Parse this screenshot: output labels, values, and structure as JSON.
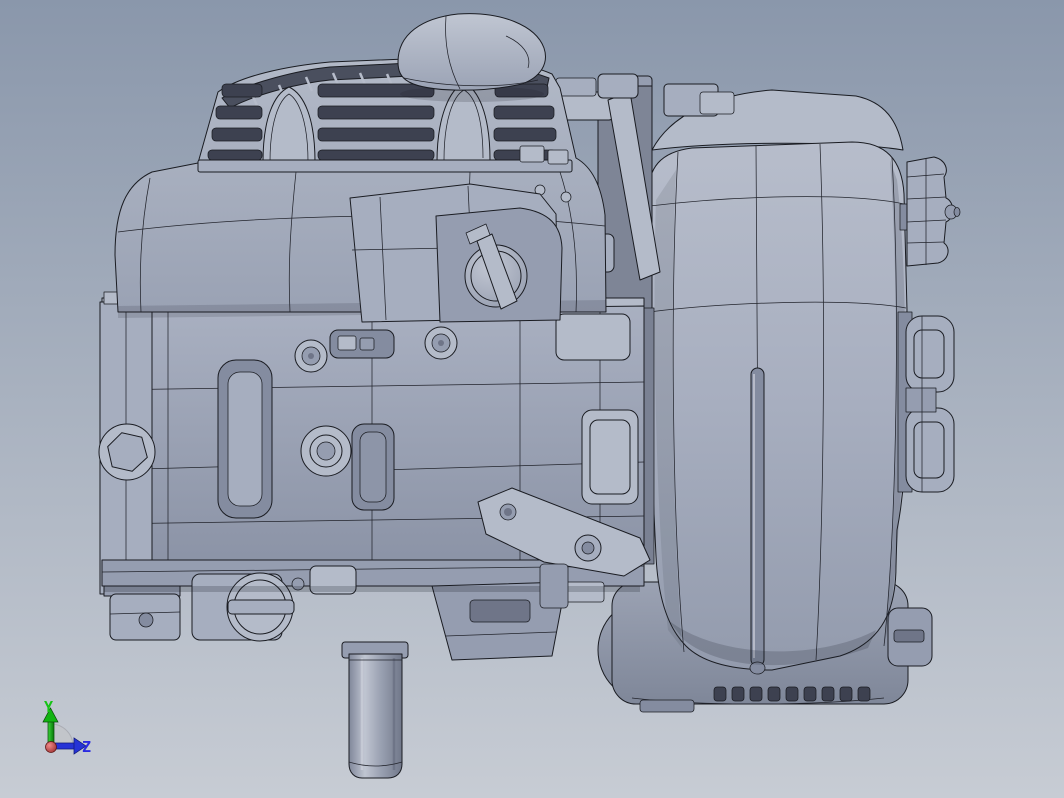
{
  "app": {
    "type": "cad-3d-viewport",
    "view": "shaded-with-edges side view of a small vertical-shaft engine assembly"
  },
  "viewport": {
    "background_top": "#8a97ab",
    "background_bottom": "#c7ccd4",
    "model_base_color": "#a6aebf",
    "model_edge_color": "#1a1c22",
    "parts": [
      "air-cleaner-cover",
      "fan-shroud",
      "valve-cover",
      "oil-filler-cap",
      "carburetor-linkage",
      "fuel-tank",
      "fuel-tank-cap",
      "air-cleaner-knob",
      "muffler-assembly",
      "crankcase",
      "engine-mount-plate",
      "hex-drain-plug",
      "oil-drain-cap",
      "governor-arm",
      "output-shaft"
    ]
  },
  "triad": {
    "y_axis": {
      "label": "Y",
      "color": "#15c415"
    },
    "z_axis": {
      "label": "Z",
      "color": "#2a2ae0"
    },
    "x_axis": {
      "label": "",
      "color": "#b23131"
    }
  }
}
